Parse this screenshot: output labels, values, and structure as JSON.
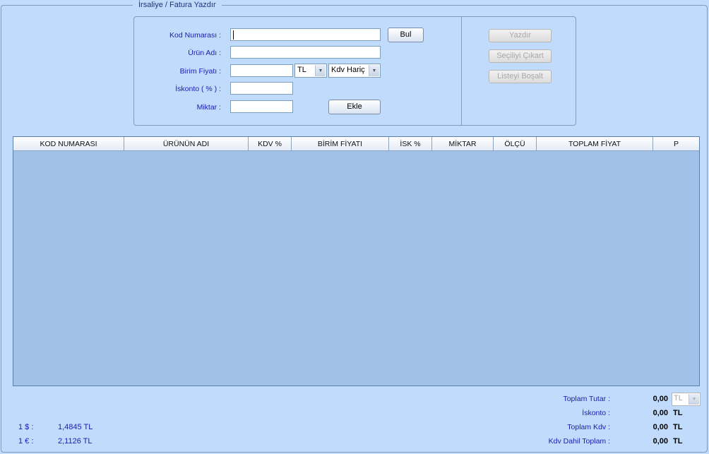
{
  "frame": {
    "title": "İrsaliye / Fatura Yazdır"
  },
  "form": {
    "kod_label": "Kod Numarası  :",
    "urun_label": "Ürün Adı  :",
    "fiyat_label": "Birim Fiyatı  :",
    "iskonto_label": "İskonto ( % )  :",
    "miktar_label": "Miktar  :",
    "kod_value": "",
    "urun_value": "",
    "fiyat_value": "",
    "iskonto_value": "",
    "miktar_value": "",
    "currency": "TL",
    "kdv_mode": "Kdv Hariç",
    "bul_button": "Bul",
    "ekle_button": "Ekle"
  },
  "actions": {
    "yazdir": "Yazdır",
    "secili_cikart": "Seçiliyi Çıkart",
    "listeyi_bosalt": "Listeyi Boşalt"
  },
  "table": {
    "columns": [
      "KOD NUMARASI",
      "ÜRÜNÜN ADI",
      "KDV %",
      "BİRİM FİYATI",
      "İSK %",
      "MİKTAR",
      "ÖLÇÜ",
      "TOPLAM FİYAT",
      "P"
    ],
    "rows": []
  },
  "totals": {
    "toplam_tutar_label": "Toplam Tutar  :",
    "toplam_tutar_value": "0,00",
    "toplam_tutar_currency": "TL",
    "iskonto_label": "İskonto  :",
    "iskonto_value": "0,00",
    "iskonto_unit": "TL",
    "toplam_kdv_label": "Toplam Kdv  :",
    "toplam_kdv_value": "0,00",
    "toplam_kdv_unit": "TL",
    "kdv_dahil_label": "Kdv Dahil Toplam  :",
    "kdv_dahil_value": "0,00",
    "kdv_dahil_unit": "TL"
  },
  "rates": {
    "usd_label": "1 $  :",
    "usd_value": "1,4845 TL",
    "eur_label": "1 €  :",
    "eur_value": "2,1126 TL"
  }
}
